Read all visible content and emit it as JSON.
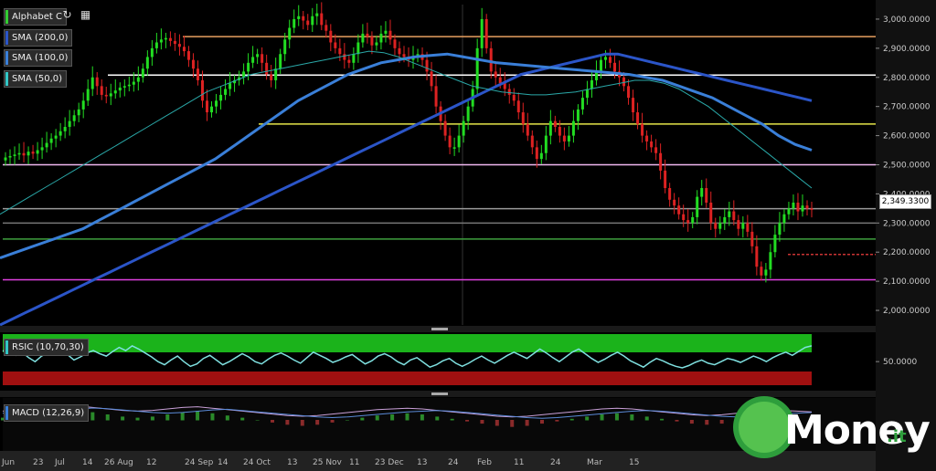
{
  "legend": [
    {
      "label": "Alphabet C",
      "color": "#33cc33"
    },
    {
      "label": "SMA (200,0)",
      "color": "#2b55c8"
    },
    {
      "label": "SMA (100,0)",
      "color": "#3a7fd8"
    },
    {
      "label": "SMA (50,0)",
      "color": "#33c6c6"
    }
  ],
  "indicators": {
    "rsi_label": "RSIC (10,70,30)",
    "rsi_tick": "50.0000",
    "macd_label": "MACD (12,26,9)"
  },
  "last_price": "2,349.3300",
  "watermark": {
    "text": "Money",
    "suffix": ".it"
  },
  "chart_data": {
    "type": "candlestick",
    "ylim": [
      1950000,
      3050000
    ],
    "y_ticks": [
      "3,000.0000",
      "2,900.0000",
      "2,800.0000",
      "2,700.0000",
      "2,600.0000",
      "2,500.0000",
      "2,400.0000",
      "2,300.0000",
      "2,200.0000",
      "2,100.0000",
      "2,000.0000"
    ],
    "y_tick_values": [
      3000000,
      2900000,
      2800000,
      2700000,
      2600000,
      2500000,
      2400000,
      2300000,
      2200000,
      2100000,
      2000000
    ],
    "x_ticks": [
      "Jun",
      "23",
      "Jul",
      "14",
      "26 Aug",
      "12",
      "24 Sep",
      "14",
      "24 Oct",
      "13",
      "25 Nov",
      "11",
      "23 Dec",
      "13",
      "24",
      "Feb",
      "11",
      "24",
      "Mar",
      "15"
    ],
    "horizontal_levels": [
      {
        "value": 2940000,
        "color": "#e8a060"
      },
      {
        "value": 2808000,
        "color": "#ffffff"
      },
      {
        "value": 2640000,
        "color": "#e6e64a"
      },
      {
        "value": 2500000,
        "color": "#f0b8f0"
      },
      {
        "value": 2349330,
        "color": "#999999"
      },
      {
        "value": 2300000,
        "color": "#777777"
      },
      {
        "value": 2245000,
        "color": "#3fa03f"
      },
      {
        "value": 2192000,
        "color": "#cc3333",
        "dashed": true
      },
      {
        "value": 2105000,
        "color": "#e040e0"
      }
    ],
    "close": [
      2525000,
      2530000,
      2535000,
      2540000,
      2532000,
      2545000,
      2538000,
      2550000,
      2560000,
      2575000,
      2590000,
      2600000,
      2615000,
      2630000,
      2650000,
      2670000,
      2690000,
      2720000,
      2760000,
      2800000,
      2770000,
      2740000,
      2735000,
      2745000,
      2755000,
      2765000,
      2770000,
      2775000,
      2785000,
      2800000,
      2830000,
      2870000,
      2900000,
      2920000,
      2930000,
      2935000,
      2925000,
      2915000,
      2905000,
      2890000,
      2860000,
      2830000,
      2790000,
      2720000,
      2680000,
      2700000,
      2720000,
      2740000,
      2760000,
      2780000,
      2790000,
      2800000,
      2820000,
      2850000,
      2870000,
      2880000,
      2850000,
      2810000,
      2790000,
      2830000,
      2880000,
      2930000,
      2970000,
      3000000,
      3010000,
      2995000,
      2980000,
      3010000,
      3020000,
      2980000,
      2960000,
      2920000,
      2900000,
      2880000,
      2860000,
      2850000,
      2880000,
      2920000,
      2950000,
      2940000,
      2910000,
      2920000,
      2950000,
      2960000,
      2930000,
      2900000,
      2880000,
      2870000,
      2860000,
      2870000,
      2880000,
      2860000,
      2820000,
      2770000,
      2700000,
      2650000,
      2600000,
      2560000,
      2560000,
      2600000,
      2650000,
      2700000,
      2760000,
      2900000,
      3000000,
      2900000,
      2820000,
      2800000,
      2780000,
      2760000,
      2740000,
      2720000,
      2680000,
      2640000,
      2600000,
      2560000,
      2520000,
      2540000,
      2600000,
      2650000,
      2630000,
      2600000,
      2580000,
      2600000,
      2650000,
      2690000,
      2730000,
      2760000,
      2790000,
      2820000,
      2860000,
      2870000,
      2850000,
      2820000,
      2800000,
      2770000,
      2730000,
      2680000,
      2640000,
      2600000,
      2580000,
      2560000,
      2540000,
      2480000,
      2420000,
      2380000,
      2360000,
      2330000,
      2310000,
      2300000,
      2320000,
      2390000,
      2420000,
      2370000,
      2300000,
      2280000,
      2300000,
      2320000,
      2340000,
      2310000,
      2280000,
      2300000,
      2270000,
      2220000,
      2150000,
      2120000,
      2140000,
      2200000,
      2260000,
      2300000,
      2330000,
      2350000,
      2370000,
      2340000,
      2360000,
      2350000,
      2349330
    ],
    "series": [
      {
        "name": "SMA (200,0)",
        "color": "#2b55c8",
        "values": [
          1950000,
          1970000,
          1990000,
          2010000,
          2030000,
          2050000,
          2070000,
          2090000,
          2110000,
          2130000,
          2150000,
          2170000,
          2190000,
          2210000,
          2230000,
          2250000,
          2270000,
          2290000,
          2310000,
          2330000,
          2350000,
          2370000,
          2390000,
          2410000,
          2430000,
          2450000,
          2470000,
          2490000,
          2510000,
          2530000,
          2550000,
          2570000,
          2590000,
          2610000,
          2630000,
          2650000,
          2670000,
          2690000,
          2710000,
          2730000,
          2750000,
          2770000,
          2790000,
          2810000,
          2820000,
          2830000,
          2840000,
          2850000,
          2860000,
          2870000,
          2880000,
          2880000,
          2870000,
          2860000,
          2850000,
          2840000,
          2830000,
          2820000,
          2810000,
          2800000,
          2790000,
          2780000,
          2770000,
          2760000,
          2750000,
          2740000,
          2730000,
          2720000
        ]
      },
      {
        "name": "SMA (100,0)",
        "color": "#3a7fd8",
        "values": [
          2180000,
          2200000,
          2220000,
          2240000,
          2260000,
          2280000,
          2310000,
          2340000,
          2370000,
          2400000,
          2430000,
          2460000,
          2490000,
          2520000,
          2560000,
          2600000,
          2640000,
          2680000,
          2720000,
          2750000,
          2780000,
          2810000,
          2830000,
          2850000,
          2860000,
          2870000,
          2875000,
          2880000,
          2870000,
          2860000,
          2850000,
          2845000,
          2840000,
          2835000,
          2830000,
          2825000,
          2820000,
          2815000,
          2810000,
          2800000,
          2790000,
          2770000,
          2750000,
          2730000,
          2700000,
          2670000,
          2640000,
          2600000,
          2570000,
          2550000
        ]
      },
      {
        "name": "SMA (50,0)",
        "color": "#2aa8a8",
        "values": [
          2330000,
          2360000,
          2390000,
          2420000,
          2450000,
          2480000,
          2510000,
          2540000,
          2570000,
          2600000,
          2630000,
          2660000,
          2690000,
          2720000,
          2750000,
          2770000,
          2790000,
          2810000,
          2820000,
          2830000,
          2840000,
          2850000,
          2860000,
          2870000,
          2880000,
          2890000,
          2885000,
          2870000,
          2850000,
          2830000,
          2810000,
          2790000,
          2770000,
          2760000,
          2750000,
          2745000,
          2740000,
          2740000,
          2745000,
          2750000,
          2760000,
          2770000,
          2780000,
          2790000,
          2790000,
          2780000,
          2760000,
          2730000,
          2700000,
          2660000,
          2620000,
          2580000,
          2540000,
          2500000,
          2460000,
          2420000
        ]
      }
    ],
    "rsi": {
      "overbought": 70,
      "oversold": 30,
      "values": [
        64,
        60,
        58,
        62,
        55,
        50,
        57,
        61,
        66,
        63,
        59,
        52,
        56,
        61,
        64,
        60,
        57,
        63,
        68,
        64,
        70,
        66,
        61,
        56,
        50,
        46,
        52,
        57,
        50,
        44,
        47,
        54,
        58,
        52,
        46,
        50,
        55,
        60,
        56,
        50,
        47,
        53,
        58,
        61,
        57,
        52,
        48,
        55,
        62,
        58,
        54,
        49,
        52,
        56,
        59,
        53,
        47,
        51,
        57,
        60,
        56,
        50,
        46,
        52,
        55,
        49,
        43,
        46,
        51,
        54,
        48,
        44,
        48,
        53,
        57,
        52,
        48,
        53,
        58,
        62,
        58,
        54,
        60,
        66,
        61,
        55,
        50,
        56,
        62,
        66,
        60,
        54,
        49,
        53,
        58,
        62,
        57,
        51,
        47,
        43,
        49,
        54,
        51,
        47,
        44,
        42,
        45,
        49,
        52,
        48,
        46,
        50,
        54,
        52,
        49,
        53,
        57,
        54,
        50,
        55,
        59,
        62,
        58,
        63,
        68,
        70
      ]
    },
    "macd": {
      "values": [
        2,
        4,
        6,
        8,
        10,
        9,
        7,
        5,
        3,
        2,
        3,
        5,
        7,
        8,
        6,
        4,
        2,
        0,
        -2,
        -4,
        -5,
        -4,
        -2,
        0,
        2,
        4,
        5,
        6,
        5,
        3,
        1,
        -1,
        -3,
        -5,
        -6,
        -5,
        -3,
        -1,
        1,
        3,
        5,
        6,
        5,
        3,
        1,
        -1,
        -3,
        -4,
        -3,
        -1,
        1,
        2,
        3,
        2,
        1
      ]
    }
  }
}
